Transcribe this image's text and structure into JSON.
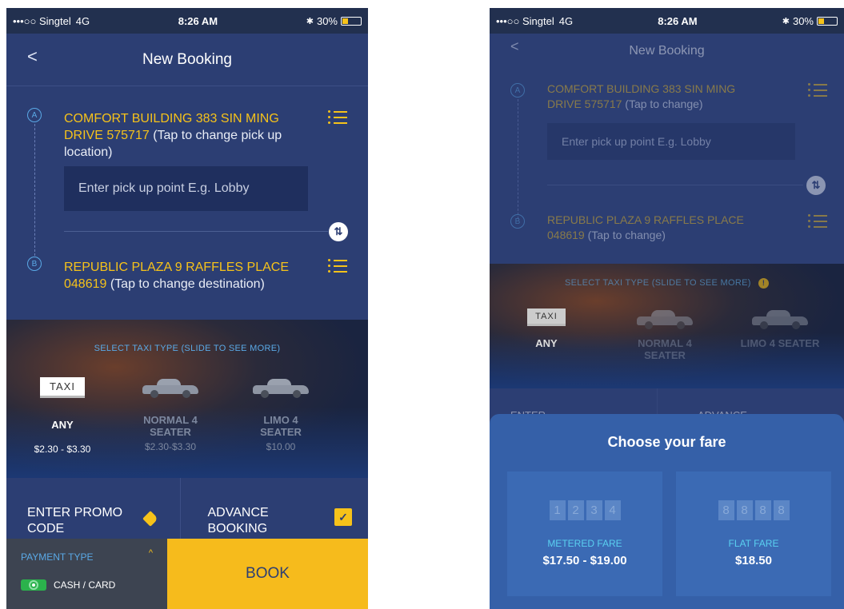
{
  "colors": {
    "accent_yellow": "#f6c21a",
    "primary_blue": "#2c3e73",
    "book_yellow": "#f6bb1c",
    "link_blue": "#5aa9e6"
  },
  "screen1": {
    "status": {
      "carrier": "•••○○ Singtel",
      "network": "4G",
      "time": "8:26 AM",
      "bluetooth": "✱",
      "battery": "30%"
    },
    "nav": {
      "title": "New Booking",
      "back": "<"
    },
    "pickup": {
      "marker": "A",
      "address": "COMFORT BUILDING 383 SIN MING DRIVE 575717",
      "hint": "(Tap to change pick up location)"
    },
    "pickup_point": {
      "placeholder": "Enter pick up point E.g. Lobby"
    },
    "swap_icon": "⇅",
    "destination": {
      "marker": "B",
      "address": "REPUBLIC PLAZA 9 RAFFLES PLACE 048619",
      "hint": "(Tap to change destination)"
    },
    "taxi": {
      "caption": "SELECT TAXI TYPE (SLIDE TO SEE MORE)",
      "options": [
        {
          "sign": "TAXI",
          "label": "ANY",
          "price": "$2.30 - $3.30"
        },
        {
          "label": "NORMAL 4 SEATER",
          "price": "$2.30-$3.30"
        },
        {
          "label": "LIMO 4 SEATER",
          "price": "$10.00"
        }
      ]
    },
    "promo": {
      "label": "ENTER PROMO CODE"
    },
    "advance": {
      "label": "ADVANCE BOOKING"
    },
    "payment": {
      "label": "PAYMENT TYPE",
      "chevron": "^",
      "value": "CASH / CARD"
    },
    "book": {
      "label": "BOOK"
    }
  },
  "screen2": {
    "status": {
      "carrier": "•••○○ Singtel",
      "network": "4G",
      "time": "8:26 AM",
      "bluetooth": "✱",
      "battery": "30%"
    },
    "nav": {
      "title": "New Booking",
      "back": "<"
    },
    "pickup": {
      "marker": "A",
      "address": "COMFORT BUILDING 383 SIN MING DRIVE 575717",
      "hint": "(Tap to change)"
    },
    "pickup_point": {
      "placeholder": "Enter pick up point E.g. Lobby"
    },
    "swap_icon": "⇅",
    "destination": {
      "marker": "B",
      "address": "REPUBLIC PLAZA 9 RAFFLES PLACE 048619",
      "hint": "(Tap to change)"
    },
    "taxi": {
      "caption": "SELECT TAXI TYPE (SLIDE TO SEE MORE)",
      "info": "!",
      "options": [
        {
          "sign": "TAXI",
          "label": "ANY"
        },
        {
          "label": "NORMAL 4 SEATER"
        },
        {
          "label": "LIMO 4 SEATER"
        }
      ]
    },
    "peek_left": "ENTER",
    "peek_right": "ADVANCE",
    "fare_sheet": {
      "title": "Choose your fare",
      "metered": {
        "digits": [
          "1",
          "2",
          "3",
          "4"
        ],
        "type": "METERED FARE",
        "amount": "$17.50 - $19.00"
      },
      "flat": {
        "digits": [
          "8",
          "8",
          "8",
          "8"
        ],
        "type": "FLAT FARE",
        "amount": "$18.50"
      }
    }
  }
}
